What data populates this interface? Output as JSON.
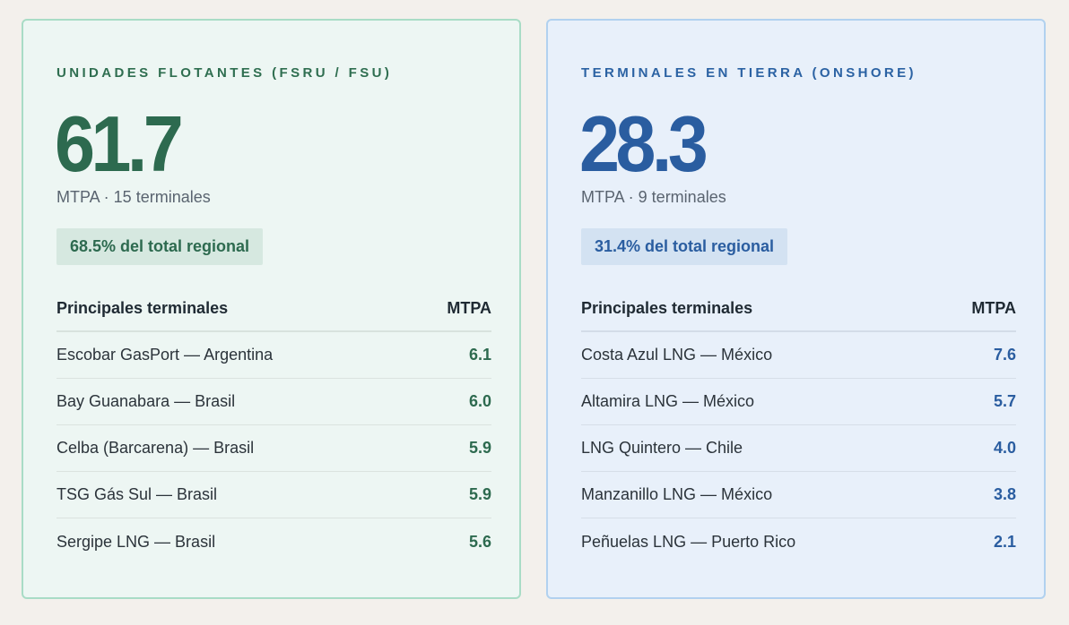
{
  "floating": {
    "eyebrow": "UNIDADES FLOTANTES (FSRU / FSU)",
    "value": "61.7",
    "subtitle": "MTPA · 15 terminales",
    "share": "68.5% del total regional",
    "table_header": "Principales terminales",
    "unit_header": "MTPA",
    "rows": [
      {
        "name": "Escobar GasPort — Argentina",
        "value": "6.1"
      },
      {
        "name": "Bay Guanabara — Brasil",
        "value": "6.0"
      },
      {
        "name": "Celba (Barcarena) — Brasil",
        "value": "5.9"
      },
      {
        "name": "TSG Gás Sul — Brasil",
        "value": "5.9"
      },
      {
        "name": "Sergipe LNG — Brasil",
        "value": "5.6"
      }
    ]
  },
  "onshore": {
    "eyebrow": "TERMINALES EN TIERRA (ONSHORE)",
    "value": "28.3",
    "subtitle": "MTPA · 9 terminales",
    "share": "31.4% del total regional",
    "table_header": "Principales terminales",
    "unit_header": "MTPA",
    "rows": [
      {
        "name": "Costa Azul LNG — México",
        "value": "7.6"
      },
      {
        "name": "Altamira LNG — México",
        "value": "5.7"
      },
      {
        "name": "LNG Quintero — Chile",
        "value": "4.0"
      },
      {
        "name": "Manzanillo LNG — México",
        "value": "3.8"
      },
      {
        "name": "Peñuelas LNG — Puerto Rico",
        "value": "2.1"
      }
    ]
  },
  "colors": {
    "floating_accent": "#2d6a4f",
    "onshore_accent": "#2a5da0",
    "background": "#f3f0ec"
  }
}
